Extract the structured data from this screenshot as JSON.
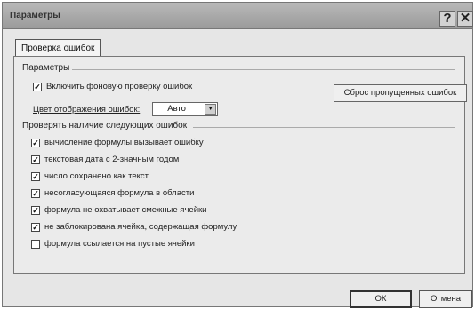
{
  "window": {
    "title": "Параметры"
  },
  "titlebar": {
    "help_glyph": "?",
    "close_glyph": "✕"
  },
  "tabs": [
    {
      "label": "Проверка ошибок",
      "active": true
    }
  ],
  "settings": {
    "heading": "Параметры",
    "background_check": {
      "label": "Включить фоновую проверку ошибок",
      "checked": true
    },
    "indicator_color": {
      "label": "Цвет отображения ошибок:",
      "value": "Авто"
    },
    "reset_button": "Сброс пропущенных ошибок"
  },
  "rules": {
    "heading": "Проверять наличие следующих ошибок",
    "items": [
      {
        "label": "вычисление формулы вызывает ошибку",
        "checked": true
      },
      {
        "label": "текстовая дата с 2-значным годом",
        "checked": true
      },
      {
        "label": "число сохранено как текст",
        "checked": true
      },
      {
        "label": "несогласующаяся формула в области",
        "checked": true
      },
      {
        "label": "формула не охватывает смежные ячейки",
        "checked": true
      },
      {
        "label": "не заблокирована ячейка, содержащая формулу",
        "checked": true
      },
      {
        "label": "формула ссылается на пустые ячейки",
        "checked": false
      }
    ]
  },
  "footer": {
    "ok_label": "ОК",
    "cancel_label": "Отмена"
  },
  "glyphs": {
    "check_mark": "✓",
    "dropdown_arrow": "▼"
  }
}
